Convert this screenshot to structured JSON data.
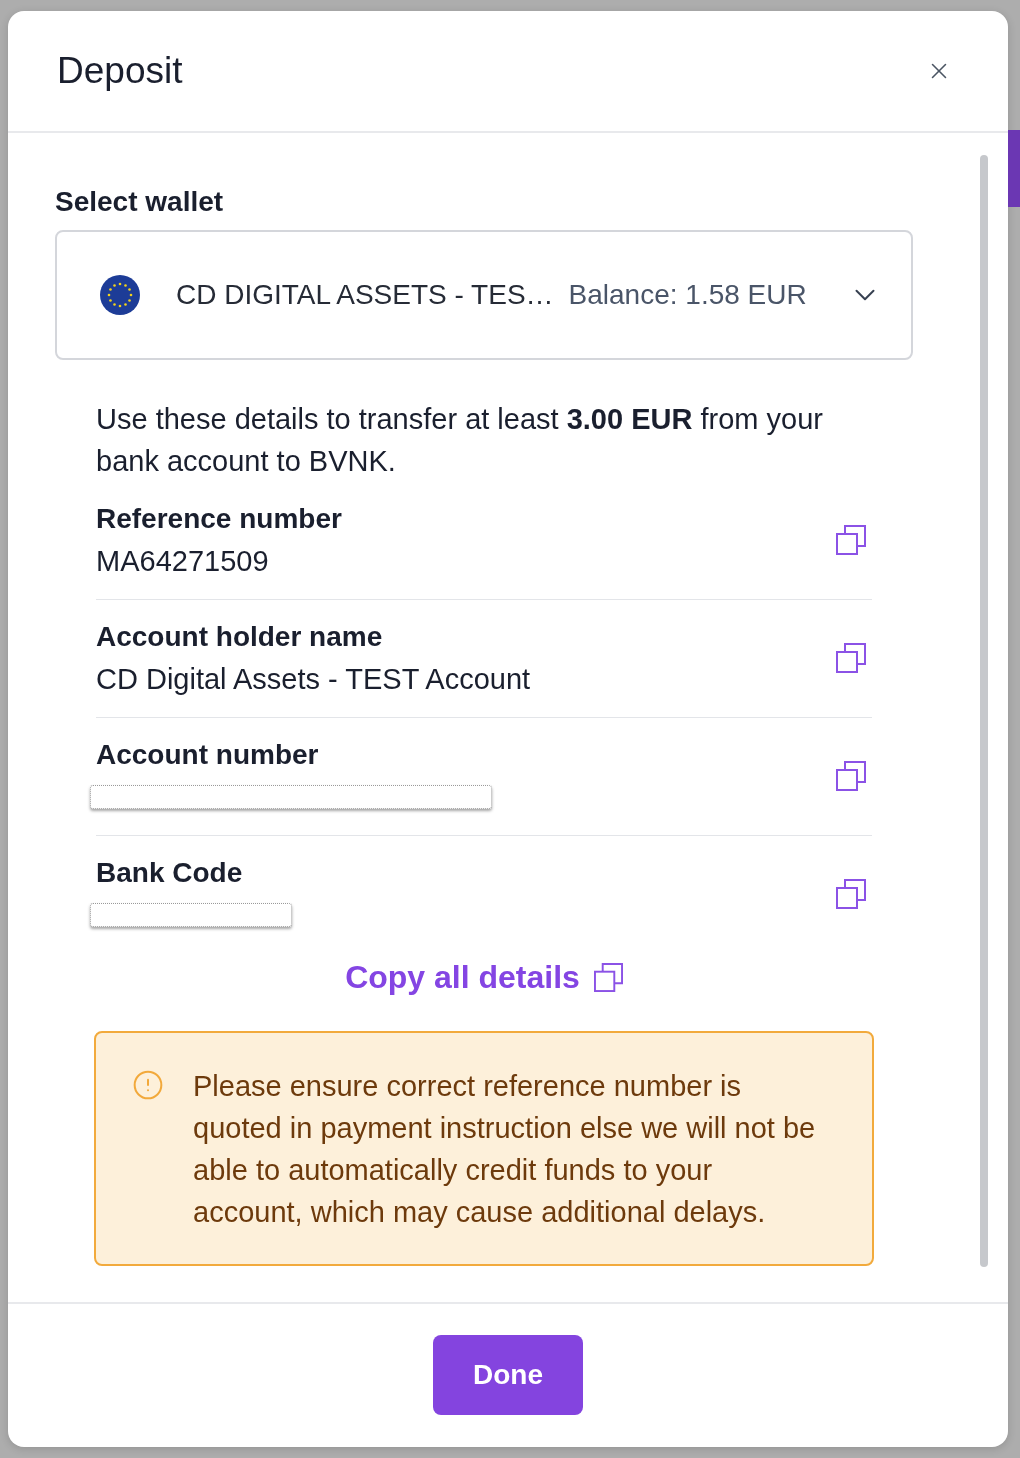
{
  "dialog": {
    "title": "Deposit"
  },
  "wallet_select": {
    "label": "Select wallet",
    "value": "CD DIGITAL ASSETS - TES…",
    "balance": "Balance: 1.58 EUR"
  },
  "instructions": "Use these details to transfer at least **3.00 EUR** from your bank account to BVNK.",
  "details": [
    {
      "label": "Reference number",
      "value": "MA64271509",
      "redacted": false
    },
    {
      "label": "Account holder name",
      "value": "CD Digital Assets - TEST Account",
      "redacted": false
    },
    {
      "label": "Account number",
      "redacted": true
    },
    {
      "label": "Bank Code",
      "redacted": true
    }
  ],
  "copy_all": "Copy all details",
  "warning": "Please ensure correct reference number is quoted in payment instruction else we will not be able to automatically credit funds to your account, which may cause additional delays.",
  "footer": {
    "button": "Done"
  }
}
